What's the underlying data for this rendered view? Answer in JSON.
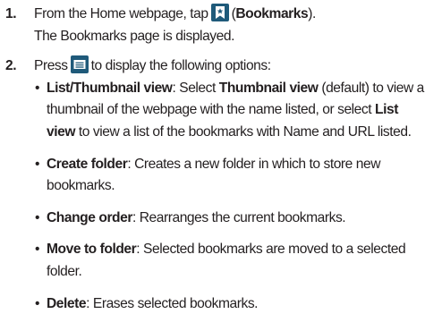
{
  "steps": [
    {
      "number": "1.",
      "line1_before": "From the Home webpage, tap",
      "icon": "bookmarks-icon",
      "line1_after_paren_open": "(",
      "line1_bold": "Bookmarks",
      "line1_after": ").",
      "line2": "The Bookmarks page is displayed."
    },
    {
      "number": "2.",
      "before_icon": "Press",
      "icon": "menu-icon",
      "after_icon": "to display the following options:",
      "options": [
        {
          "bold": "List/Thumbnail view",
          "t1": ": Select ",
          "b2": "Thumbnail view",
          "t2": " (default) to view a thumbnail of the webpage with the name listed, or select ",
          "b3": "List view",
          "t3": " to view a list of the bookmarks with Name and URL listed."
        },
        {
          "bold": "Create folder",
          "text": ": Creates a new folder in which to store new bookmarks."
        },
        {
          "bold": "Change order",
          "text": ": Rearranges the current bookmarks."
        },
        {
          "bold": "Move to folder",
          "text": ": Selected bookmarks are moved to a selected folder."
        },
        {
          "bold": "Delete",
          "text": ": Erases selected bookmarks."
        }
      ]
    }
  ],
  "bullet": "•",
  "colors": {
    "text": "#231f20",
    "icon_background": "#1f5a7a",
    "icon_foreground": "#ffffff"
  }
}
